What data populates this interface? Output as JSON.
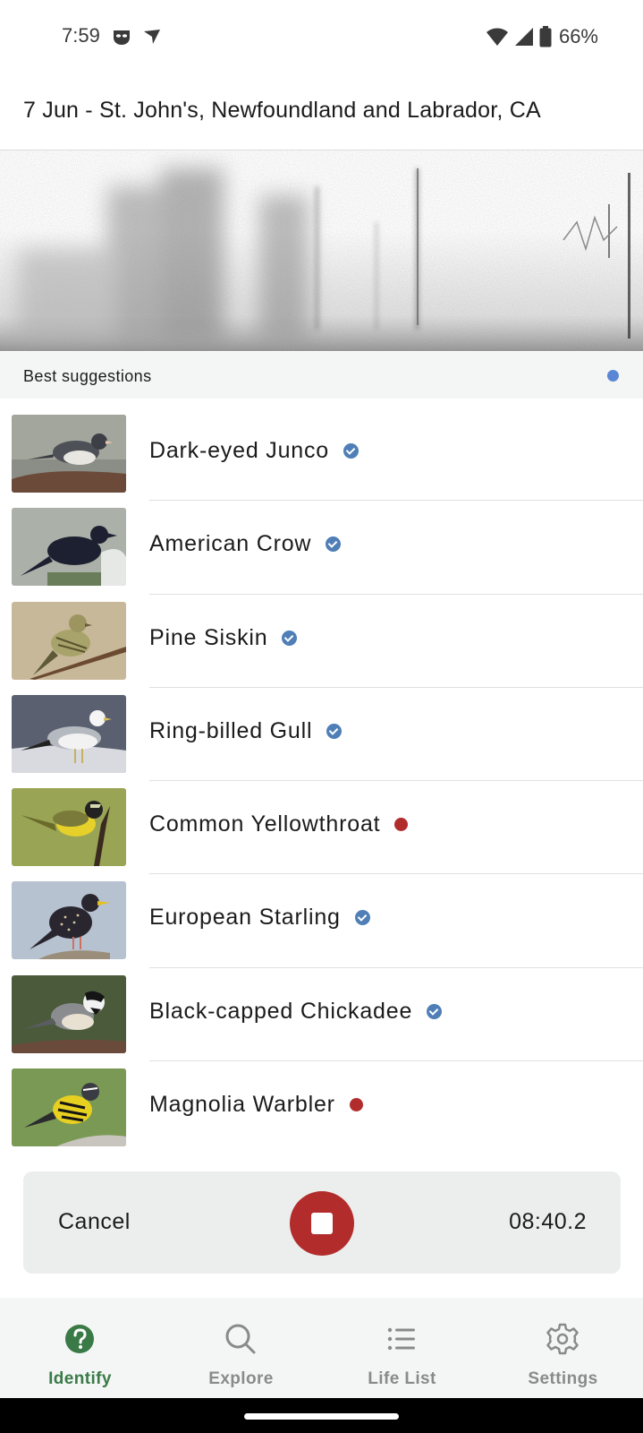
{
  "status_bar": {
    "time": "7:59",
    "battery": "66%"
  },
  "header": {
    "title": "7 Jun - St. John's, Newfoundland and Labrador, CA"
  },
  "suggestions": {
    "label": "Best suggestions",
    "indicator_color": "#5b86d6"
  },
  "species": [
    {
      "name": "Dark-eyed Junco",
      "badge": "verified"
    },
    {
      "name": "American Crow",
      "badge": "verified"
    },
    {
      "name": "Pine Siskin",
      "badge": "verified"
    },
    {
      "name": "Ring-billed Gull",
      "badge": "verified"
    },
    {
      "name": "Common Yellowthroat",
      "badge": "rare"
    },
    {
      "name": "European Starling",
      "badge": "verified"
    },
    {
      "name": "Black-capped Chickadee",
      "badge": "verified"
    },
    {
      "name": "Magnolia Warbler",
      "badge": "rare"
    }
  ],
  "recording": {
    "cancel_label": "Cancel",
    "elapsed": "08:40.2",
    "stop_color": "#b22c2c"
  },
  "nav": {
    "items": [
      {
        "label": "Identify",
        "icon": "question-circle-icon",
        "active": true
      },
      {
        "label": "Explore",
        "icon": "search-icon",
        "active": false
      },
      {
        "label": "Life List",
        "icon": "list-icon",
        "active": false
      },
      {
        "label": "Settings",
        "icon": "gear-icon",
        "active": false
      }
    ]
  },
  "colors": {
    "accent_green": "#3a7a46",
    "verified_blue": "#4f7fb6",
    "rare_red": "#b22c2c"
  }
}
